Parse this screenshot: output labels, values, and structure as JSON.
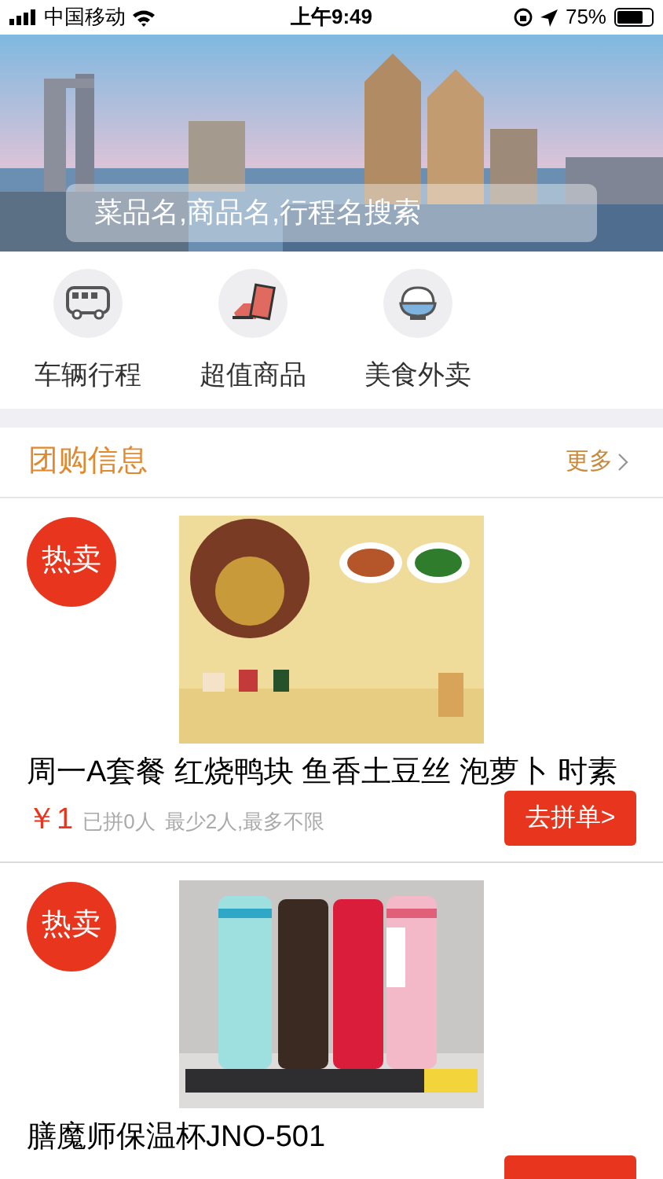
{
  "status_bar": {
    "carrier": "中国移动",
    "time": "上午9:49",
    "battery": "75%"
  },
  "banner": {
    "kind": "picture",
    "search": {
      "placeholder": "菜品名,商品名,行程名搜索"
    }
  },
  "shortcuts": [
    {
      "label": "车辆行程",
      "kind": "bus"
    },
    {
      "label": "超值商品",
      "kind": "goods"
    },
    {
      "label": "美食外卖",
      "kind": "food"
    }
  ],
  "group_buy": {
    "title": "团购信息",
    "more": "更多"
  },
  "items": [
    {
      "badge": "热卖",
      "kind": "picture",
      "title": "周一A套餐 红烧鸭块 鱼香土豆丝 泡萝卜 时素",
      "price": "￥1",
      "joined": "已拼0人",
      "limits": "最少2人,最多不限",
      "button": "去拼单>"
    },
    {
      "badge": "热卖",
      "kind": "picture",
      "title": "膳魔师保温杯JNO-501"
    }
  ]
}
